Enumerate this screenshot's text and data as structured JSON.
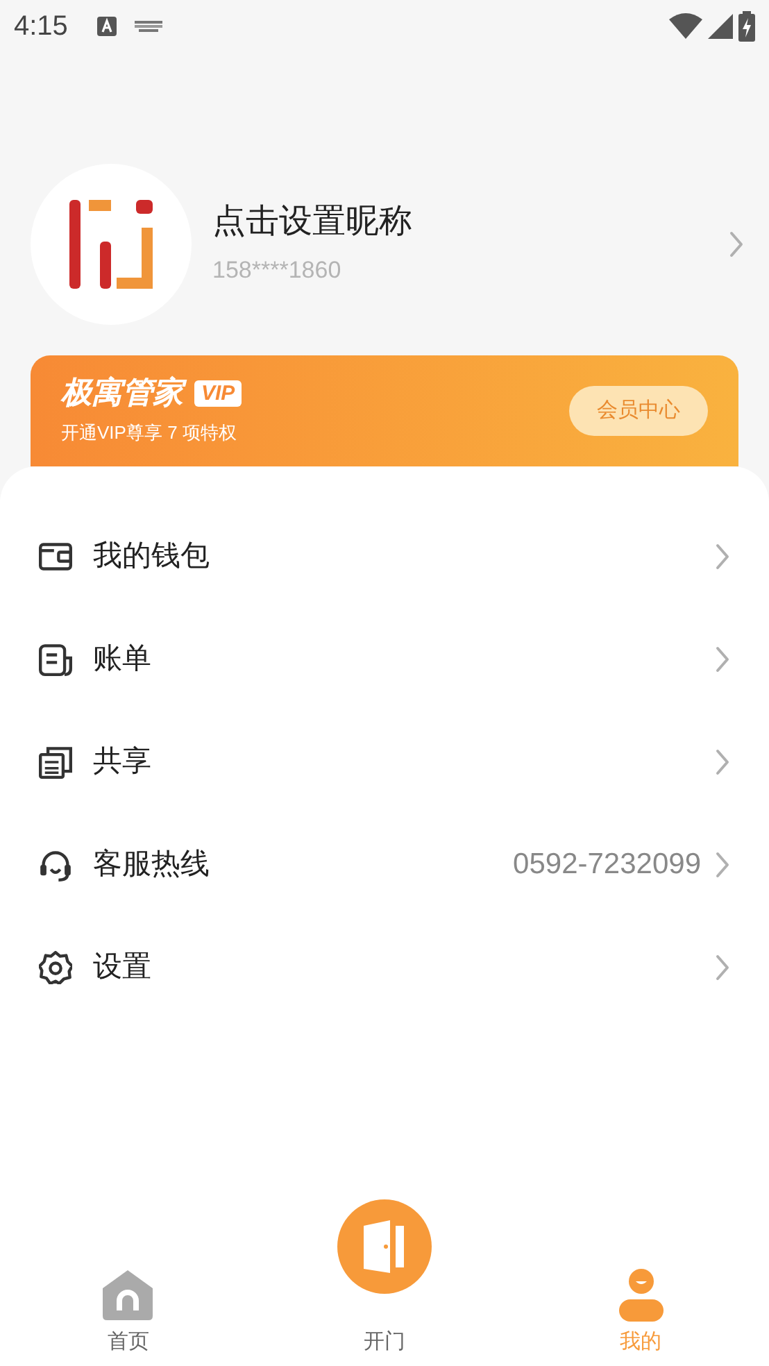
{
  "status_bar": {
    "time": "4:15"
  },
  "profile": {
    "nickname": "点击设置昵称",
    "phone": "158****1860"
  },
  "vip_card": {
    "brand": "极寓管家",
    "badge": "VIP",
    "subtitle": "开通VIP尊享 7 项特权",
    "button": "会员中心"
  },
  "menu": [
    {
      "kind": "wallet",
      "label": "我的钱包"
    },
    {
      "kind": "bill",
      "label": "账单"
    },
    {
      "kind": "share",
      "label": "共享"
    },
    {
      "kind": "headset",
      "label": "客服热线",
      "value": "0592-7232099"
    },
    {
      "kind": "settings",
      "label": "设置"
    }
  ],
  "nav": [
    {
      "kind": "home",
      "label": "首页",
      "selected": false
    },
    {
      "kind": "door",
      "label": "开门",
      "selected": false
    },
    {
      "kind": "person",
      "label": "我的",
      "selected": true
    }
  ]
}
